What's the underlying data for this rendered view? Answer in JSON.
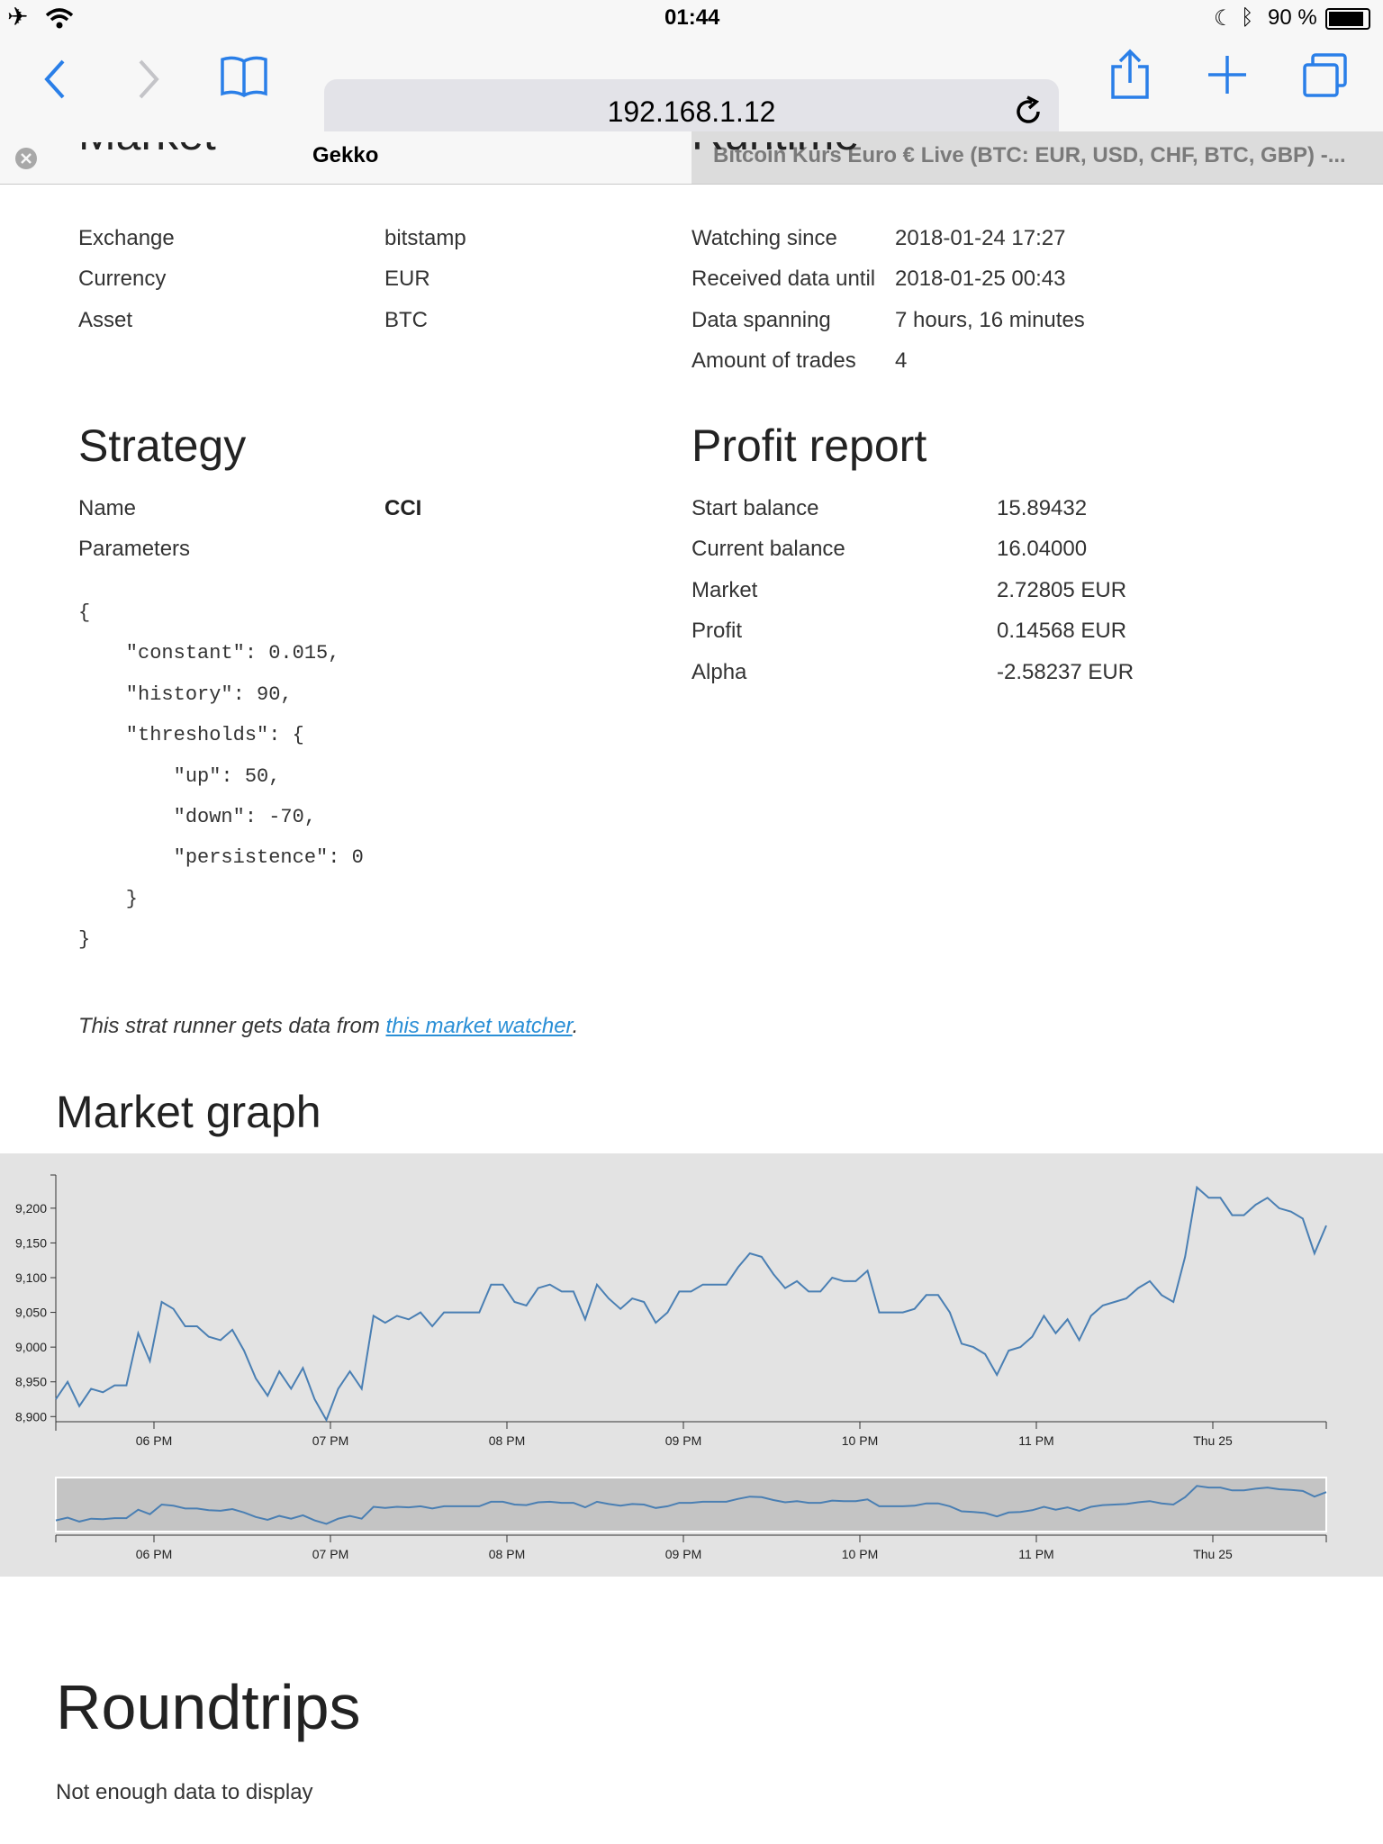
{
  "status": {
    "time": "01:44",
    "battery": "90 %"
  },
  "browser": {
    "url": "192.168.1.12",
    "tabs": [
      {
        "label": "Gekko"
      },
      {
        "label": "Bitcoin Kurs Euro € Live (BTC: EUR, USD, CHF, BTC, GBP) -..."
      }
    ]
  },
  "market": {
    "rows": [
      {
        "label": "Exchange",
        "value": "bitstamp"
      },
      {
        "label": "Currency",
        "value": "EUR"
      },
      {
        "label": "Asset",
        "value": "BTC"
      }
    ]
  },
  "runtime": {
    "rows": [
      {
        "label": "Watching since",
        "value": "2018-01-24 17:27"
      },
      {
        "label": "Received data until",
        "value": "2018-01-25 00:43"
      },
      {
        "label": "Data spanning",
        "value": "7 hours, 16 minutes"
      },
      {
        "label": "Amount of trades",
        "value": "4"
      }
    ]
  },
  "strategy": {
    "title": "Strategy",
    "name_label": "Name",
    "name_value": "CCI",
    "params_label": "Parameters",
    "params_lines": [
      "{",
      "    \"constant\": 0.015,",
      "    \"history\": 90,",
      "    \"thresholds\": {",
      "        \"up\": 50,",
      "        \"down\": -70,",
      "        \"persistence\": 0",
      "    }",
      "}"
    ],
    "note_prefix": "This strat runner gets data from ",
    "note_link": "this market watcher",
    "note_suffix": "."
  },
  "profit": {
    "title": "Profit report",
    "rows": [
      {
        "label": "Start balance",
        "value": "15.89432"
      },
      {
        "label": "Current balance",
        "value": "16.04000"
      },
      {
        "label": "Market",
        "value": "2.72805 EUR"
      },
      {
        "label": "Profit",
        "value": "0.14568 EUR"
      },
      {
        "label": "Alpha",
        "value": "-2.58237 EUR"
      }
    ]
  },
  "graph": {
    "title": "Market graph"
  },
  "roundtrips": {
    "title": "Roundtrips",
    "empty_text": "Not enough data to display"
  },
  "chart_data": {
    "type": "line",
    "series": [
      {
        "values": [
          8925,
          8950,
          8915,
          8940,
          8935,
          8945,
          8945,
          9020,
          8980,
          9065,
          9055,
          9030,
          9030,
          9015,
          9010,
          9025,
          8995,
          8955,
          8930,
          8965,
          8940,
          8970,
          8925,
          8895,
          8940,
          8965,
          8940,
          9045,
          9035,
          9045,
          9040,
          9050,
          9030,
          9050,
          9050,
          9050,
          9050,
          9090,
          9090,
          9065,
          9060,
          9085,
          9090,
          9080,
          9080,
          9040,
          9090,
          9070,
          9055,
          9070,
          9065,
          9035,
          9050,
          9080,
          9080,
          9090,
          9090,
          9090,
          9115,
          9135,
          9130,
          9105,
          9085,
          9095,
          9080,
          9080,
          9100,
          9095,
          9095,
          9110,
          9050,
          9050,
          9050,
          9055,
          9075,
          9075,
          9050,
          9005,
          9000,
          8990,
          8960,
          8995,
          9000,
          9015,
          9045,
          9020,
          9040,
          9010,
          9045,
          9060,
          9065,
          9070,
          9085,
          9095,
          9075,
          9065,
          9130,
          9230,
          9215,
          9215,
          9190,
          9190,
          9205,
          9215,
          9200,
          9195,
          9185,
          9135,
          9175
        ]
      }
    ],
    "x_ticks": [
      "06 PM",
      "07 PM",
      "08 PM",
      "09 PM",
      "10 PM",
      "11 PM",
      "Thu 25"
    ],
    "y_ticks": [
      "8,900",
      "8,950",
      "9,000",
      "9,050",
      "9,100",
      "9,150",
      "9,200"
    ],
    "ylim": [
      8890,
      9240
    ]
  }
}
